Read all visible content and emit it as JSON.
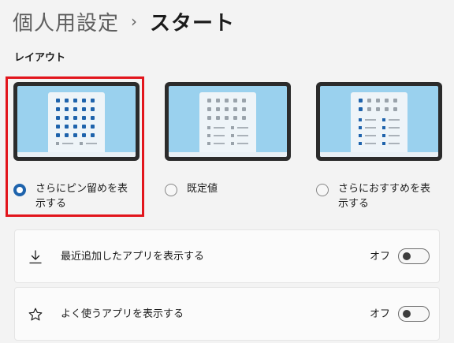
{
  "breadcrumb": {
    "parent": "個人用設定",
    "separator": "›",
    "current": "スタート"
  },
  "layout_section": {
    "title": "レイアウト",
    "options": [
      {
        "label": "さらにピン留めを表示する",
        "selected": true,
        "preview_icon": "start-menu-more-pins-icon"
      },
      {
        "label": "既定値",
        "selected": false,
        "preview_icon": "start-menu-default-icon"
      },
      {
        "label": "さらにおすすめを表示する",
        "selected": false,
        "preview_icon": "start-menu-more-recommendations-icon"
      }
    ]
  },
  "settings": [
    {
      "icon": "download-icon",
      "label": "最近追加したアプリを表示する",
      "state": "オフ",
      "on": false
    },
    {
      "icon": "star-icon",
      "label": "よく使うアプリを表示する",
      "state": "オフ",
      "on": false
    }
  ],
  "colors": {
    "accent": "#1e63ac",
    "highlight_box": "#e2151c",
    "preview_background": "#9ad1ee"
  }
}
